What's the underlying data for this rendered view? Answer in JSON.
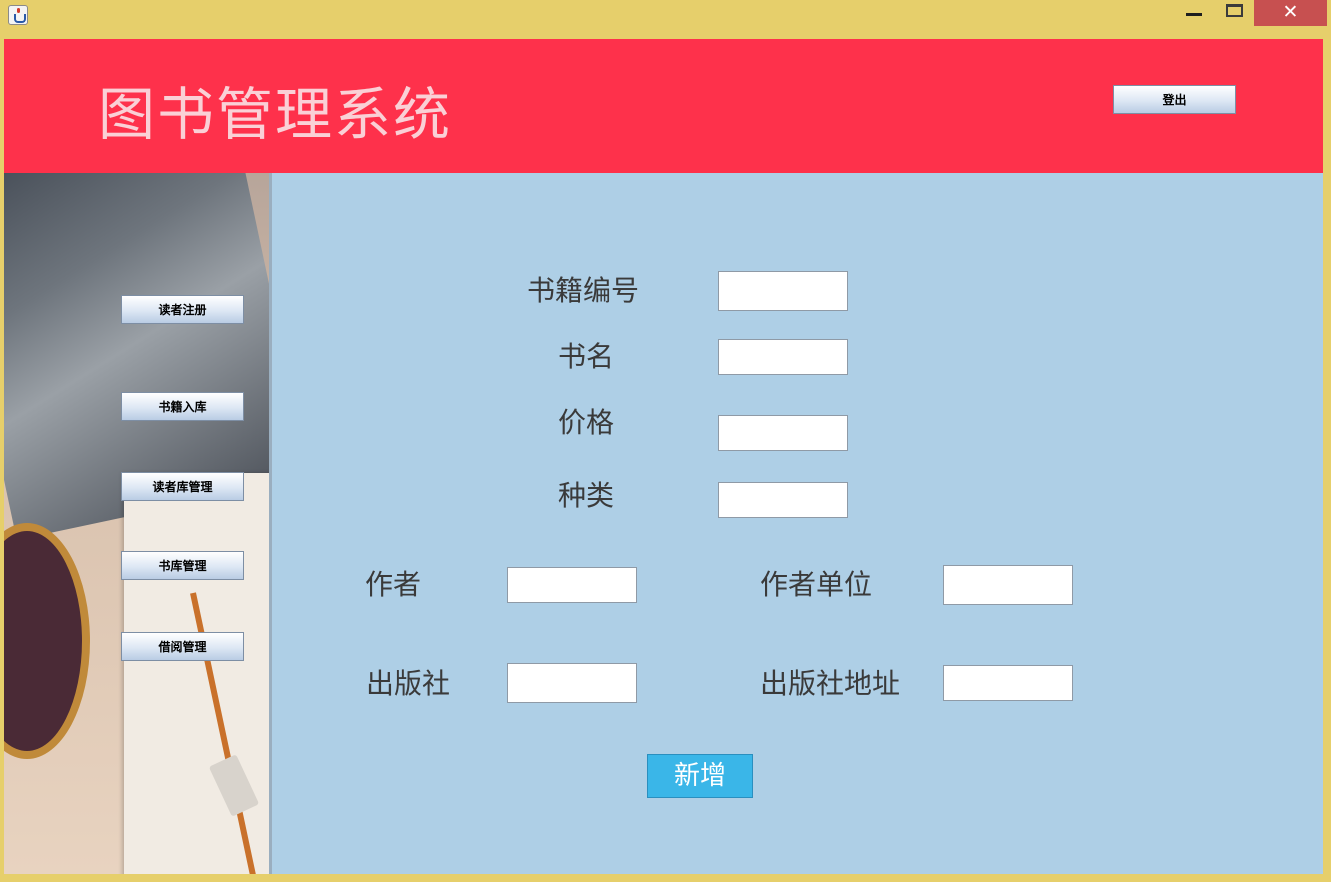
{
  "window": {
    "close_glyph": "✕"
  },
  "header": {
    "title": "图书管理系统",
    "logout_label": "登出",
    "background_color": "#fe314b"
  },
  "sidebar": {
    "items": [
      {
        "label": "读者注册"
      },
      {
        "label": "书籍入库"
      },
      {
        "label": "读者库管理"
      },
      {
        "label": "书库管理"
      },
      {
        "label": "借阅管理"
      }
    ]
  },
  "form": {
    "fields": {
      "book_id": {
        "label": "书籍编号",
        "value": ""
      },
      "title": {
        "label": "书名",
        "value": ""
      },
      "price": {
        "label": "价格",
        "value": ""
      },
      "category": {
        "label": "种类",
        "value": ""
      },
      "author": {
        "label": "作者",
        "value": ""
      },
      "author_unit": {
        "label": "作者单位",
        "value": ""
      },
      "publisher": {
        "label": "出版社",
        "value": ""
      },
      "publisher_address": {
        "label": "出版社地址",
        "value": ""
      }
    },
    "submit_label": "新增",
    "background_color": "#aecfe6"
  }
}
